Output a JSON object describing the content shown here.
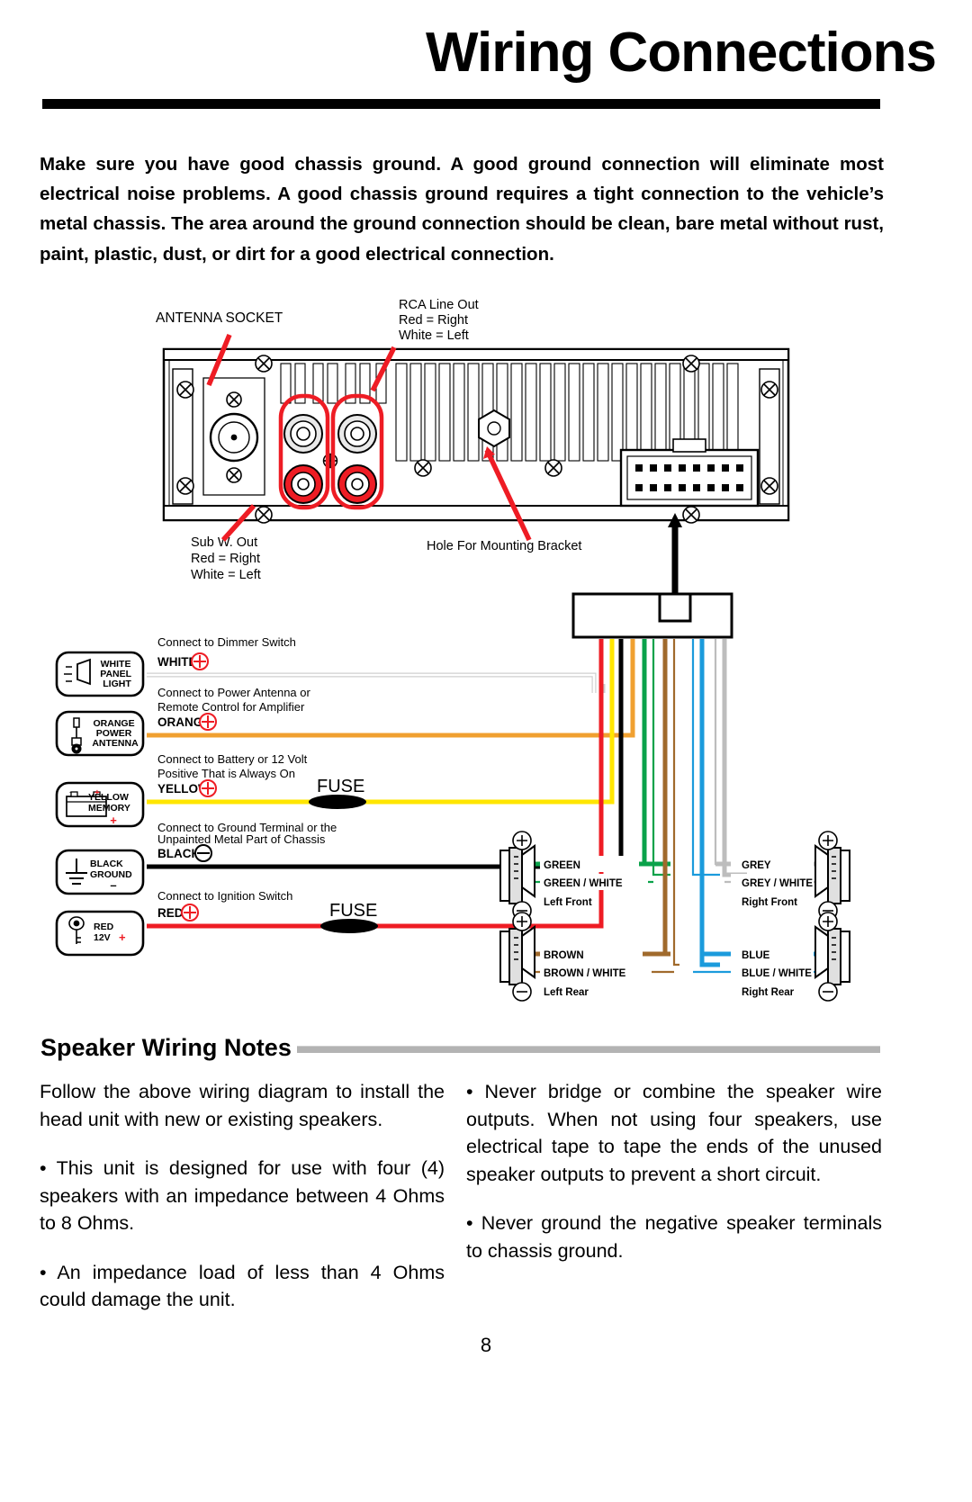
{
  "header": {
    "title": "Wiring Connections"
  },
  "intro": {
    "text": "Make sure you have good chassis ground. A good ground connection will eliminate most electrical noise problems. A good chassis ground requires a tight connection to the vehicle’s metal chassis. The area around the ground connection should be clean, bare metal without rust, paint, plastic, dust, or dirt for a good electrical connection."
  },
  "diagram": {
    "callouts": {
      "antenna_socket": "ANTENNA  SOCKET",
      "rca_line_out": [
        "RCA Line Out",
        "Red = Right",
        "White = Left"
      ],
      "sub_w_out": [
        "Sub W. Out",
        "Red = Right",
        "White = Left"
      ],
      "mounting_bracket": "Hole For Mounting Bracket"
    },
    "wire_boxes": [
      {
        "id": "white-panel-light",
        "icon": "panel-light-icon",
        "lines": [
          "WHITE",
          "PANEL",
          "LIGHT"
        ],
        "sign": ""
      },
      {
        "id": "orange-power-antenna",
        "icon": "power-antenna-icon",
        "lines": [
          "ORANGE",
          "POWER",
          "ANTENNA"
        ],
        "sign": ""
      },
      {
        "id": "yellow-memory",
        "icon": "battery-icon",
        "lines": [
          "YELLOW",
          "MEMORY"
        ],
        "sign": "+"
      },
      {
        "id": "black-ground",
        "icon": "ground-icon",
        "lines": [
          "BLACK",
          "GROUND"
        ],
        "sign": "–"
      },
      {
        "id": "red-12v",
        "icon": "key-icon",
        "lines": [
          "RED",
          "12V"
        ],
        "sign": "+"
      }
    ],
    "wire_labels": [
      {
        "id": "white-wire",
        "instruction": [
          "Connect to Dimmer Switch"
        ],
        "name": "WHITE",
        "polarity": "+",
        "color": "#ffffff"
      },
      {
        "id": "orange-wire",
        "instruction": [
          "Connect to Power Antenna or",
          "Remote Control for Amplifier"
        ],
        "name": "ORANGE",
        "polarity": "+",
        "color": "#f0a030"
      },
      {
        "id": "yellow-wire",
        "instruction": [
          "Connect to Battery or 12 Volt",
          "Positive That is Always On"
        ],
        "name": "YELLOW",
        "polarity": "+",
        "color": "#ffe600"
      },
      {
        "id": "black-wire",
        "instruction": [
          "Connect to Ground Terminal or the",
          "Unpainted Metal Part of Chassis"
        ],
        "name": "BLACK",
        "polarity": "–",
        "color": "#000000"
      },
      {
        "id": "red-wire",
        "instruction": [
          "Connect to Ignition Switch"
        ],
        "name": "RED",
        "polarity": "+",
        "color": "#ee1c24"
      }
    ],
    "fuse_labels": [
      "FUSE",
      "FUSE"
    ],
    "speakers": [
      {
        "id": "left-front",
        "wire": "GREEN",
        "wire_white": "GREEN / WHITE",
        "position": "Left Front",
        "color": "#0aa24a"
      },
      {
        "id": "right-front",
        "wire": "GREY",
        "wire_white": "GREY / WHITE",
        "position": "Right Front",
        "color": "#bdbdbd"
      },
      {
        "id": "left-rear",
        "wire": "BROWN",
        "wire_white": "BROWN / WHITE",
        "position": "Left Rear",
        "color": "#a06a2c"
      },
      {
        "id": "right-rear",
        "wire": "BLUE",
        "wire_white": "BLUE / WHITE",
        "position": "Right Rear",
        "color": "#1b9bdc"
      }
    ],
    "terminal_symbols": {
      "positive": "+",
      "negative": "−"
    }
  },
  "notes": {
    "heading": "Speaker Wiring Notes",
    "left_column": [
      "Follow the above wiring diagram to install the head unit with new or existing speakers.",
      "• This unit is designed for use with four (4) speakers with an impedance between 4 Ohms to 8 Ohms.",
      "• An impedance load of less than 4 Ohms could damage the unit."
    ],
    "right_column": [
      "• Never bridge or combine the speaker wire outputs. When not using four speakers, use electrical tape to tape the ends of the unused speaker outputs to prevent a short circuit.",
      "• Never ground the negative speaker terminals to chassis ground."
    ]
  },
  "footer": {
    "page_number": "8"
  },
  "colors": {
    "accent_red": "#ee1c24",
    "green": "#0aa24a",
    "brown": "#a06a2c",
    "blue": "#1b9bdc",
    "grey": "#bdbdbd",
    "orange": "#f0a030",
    "yellow": "#ffe600",
    "rule_grey": "#b3b3b3"
  }
}
